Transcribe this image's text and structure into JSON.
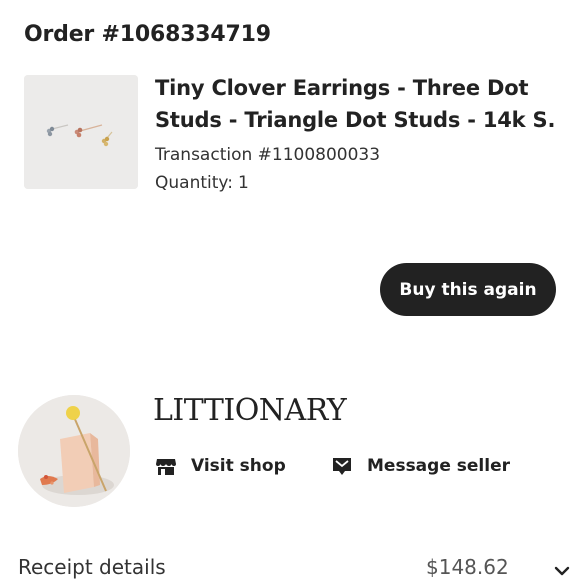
{
  "order": {
    "title": "Order #1068334719"
  },
  "item": {
    "title_line1": "Tiny Clover Earrings - Three Dot",
    "title_line2": "Studs - Triangle Dot Studs - 14k S...",
    "transaction": "Transaction #1100800033",
    "quantity_label": "Quantity:",
    "quantity_value": "1",
    "image_icon": "earrings-photo"
  },
  "actions": {
    "buy_again_label": "Buy this again"
  },
  "shop": {
    "name": "LITTIONARY",
    "visit_label": "Visit shop",
    "message_label": "Message seller",
    "visit_icon": "shop-icon",
    "message_icon": "message-icon"
  },
  "receipt": {
    "label": "Receipt details",
    "amount": "$148.62"
  },
  "colors": {
    "button_bg": "#222222",
    "button_text": "#ffffff",
    "text": "#222222"
  }
}
